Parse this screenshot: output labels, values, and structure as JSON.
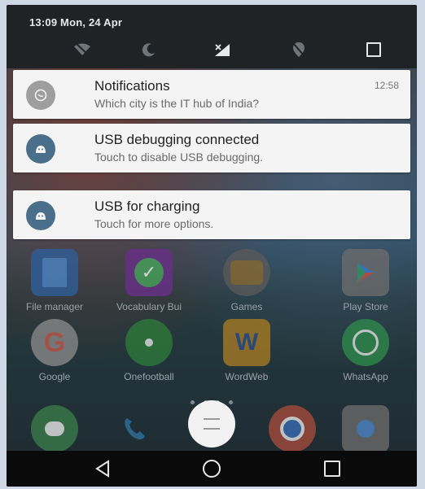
{
  "status_bar": {
    "time_date": "13:09  Mon, 24 Apr"
  },
  "quick_settings": {
    "icons": [
      "wifi-off-icon",
      "do-not-disturb-moon-icon",
      "signal-no-sim-icon",
      "location-off-icon",
      "recents-square-icon"
    ]
  },
  "notifications": [
    {
      "title": "Notifications",
      "subtitle": "Which city is the IT hub of India?",
      "time": "12:58",
      "icon": "chat-bubble-icon",
      "icon_color": "#9e9e9e"
    },
    {
      "title": "USB debugging connected",
      "subtitle": "Touch to disable USB debugging.",
      "time": "",
      "icon": "android-icon",
      "icon_color": "#4a6f8a"
    },
    {
      "title": "USB for charging",
      "subtitle": "Touch for more options.",
      "time": "",
      "icon": "android-icon",
      "icon_color": "#4a6f8a"
    }
  ],
  "apps": [
    {
      "label": "File manager",
      "icon": "folder-icon",
      "color": "#2f5f9a"
    },
    {
      "label": "Vocabulary Bui",
      "icon": "check-icon",
      "color": "#6a2f8a"
    },
    {
      "label": "Games",
      "icon": "games-icon",
      "color": "#5a5a5a"
    },
    {
      "label": "Play Store",
      "icon": "play-store-icon",
      "color": "#6c6c6c"
    },
    {
      "label": "Google",
      "icon": "google-icon",
      "color": "#8a8a8a"
    },
    {
      "label": "Onefootball",
      "icon": "football-icon",
      "color": "#2f7a3a"
    },
    {
      "label": "WordWeb",
      "icon": "wordweb-icon",
      "color": "#a87b23"
    },
    {
      "label": "WhatsApp",
      "icon": "whatsapp-icon",
      "color": "#2f8a4a"
    }
  ],
  "dock": [
    {
      "icon": "hangouts-icon",
      "color": "#3a7a4a"
    },
    {
      "icon": "phone-icon",
      "color": "#2f6f9a"
    },
    {
      "icon": "app-drawer-icon",
      "color": "#f2f2f2"
    },
    {
      "icon": "chrome-icon",
      "color": "#a34a3a"
    },
    {
      "icon": "camera-icon",
      "color": "#6a6a6a"
    }
  ],
  "nav_bar": {
    "icons": [
      "back-icon",
      "home-icon",
      "recents-icon"
    ]
  }
}
